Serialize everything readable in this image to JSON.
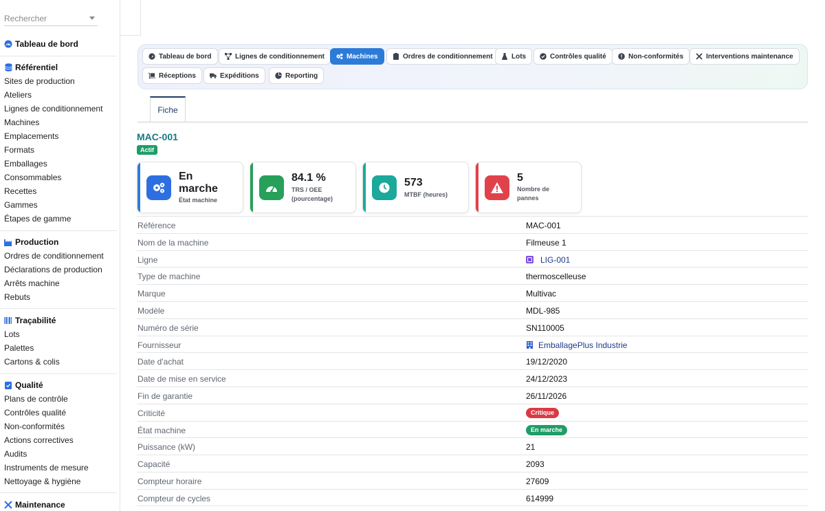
{
  "search": {
    "placeholder": "Rechercher"
  },
  "sidebar": {
    "dashboard": "Tableau de bord",
    "referentiel": {
      "title": "Référentiel",
      "items": [
        "Sites de production",
        "Ateliers",
        "Lignes de conditionnement",
        "Machines",
        "Emplacements",
        "Formats",
        "Emballages",
        "Consommables",
        "Recettes",
        "Gammes",
        "Étapes de gamme"
      ]
    },
    "production": {
      "title": "Production",
      "items": [
        "Ordres de conditionnement",
        "Déclarations de production",
        "Arrêts machine",
        "Rebuts"
      ]
    },
    "tracabilite": {
      "title": "Traçabilité",
      "items": [
        "Lots",
        "Palettes",
        "Cartons & colis"
      ]
    },
    "qualite": {
      "title": "Qualité",
      "items": [
        "Plans de contrôle",
        "Contrôles qualité",
        "Non-conformités",
        "Actions correctives",
        "Audits",
        "Instruments de mesure",
        "Nettoyage & hygiène"
      ]
    },
    "maintenance": {
      "title": "Maintenance"
    }
  },
  "nav_tabs": [
    "Tableau de bord",
    "Lignes de conditionnement",
    "Machines",
    "Ordres de conditionnement",
    "Lots",
    "Contrôles qualité",
    "Non-conformités",
    "Interventions maintenance",
    "Réceptions",
    "Expéditions",
    "Reporting"
  ],
  "active_tab": "Machines",
  "sub_tab": "Fiche",
  "record": {
    "code": "MAC-001",
    "status": "Actif"
  },
  "kpis": [
    {
      "value": "En marche",
      "label": "État machine",
      "color": "#2d6fe0",
      "bar": "#2d7bd8"
    },
    {
      "value": "84.1 %",
      "label": "TRS / OEE (pourcentage)",
      "color": "#27a05a",
      "bar": "#27a05a"
    },
    {
      "value": "573",
      "label": "MTBF (heures)",
      "color": "#1aa99a",
      "bar": "#1aa99a"
    },
    {
      "value": "5",
      "label": "Nombre de pannes",
      "color": "#e0424b",
      "bar": "#e0424b"
    }
  ],
  "fields": [
    {
      "label": "Référence",
      "value": "MAC-001"
    },
    {
      "label": "Nom de la machine",
      "value": "Filmeuse 1"
    },
    {
      "label": "Ligne",
      "value": "LIG-001"
    },
    {
      "label": "Type de machine",
      "value": "thermoscelleuse"
    },
    {
      "label": "Marque",
      "value": "Multivac"
    },
    {
      "label": "Modèle",
      "value": "MDL-985"
    },
    {
      "label": "Numéro de série",
      "value": "SN110005"
    },
    {
      "label": "Fournisseur",
      "value": "EmballagePlus Industrie"
    },
    {
      "label": "Date d'achat",
      "value": "19/12/2020"
    },
    {
      "label": "Date de mise en service",
      "value": "24/12/2023"
    },
    {
      "label": "Fin de garantie",
      "value": "26/11/2026"
    },
    {
      "label": "Criticité",
      "value": "Critique"
    },
    {
      "label": "État machine",
      "value": "En marche"
    },
    {
      "label": "Puissance (kW)",
      "value": "21"
    },
    {
      "label": "Capacité",
      "value": "2093"
    },
    {
      "label": "Compteur horaire",
      "value": "27609"
    },
    {
      "label": "Compteur de cycles",
      "value": "614999"
    }
  ],
  "colors": {
    "accent": "#2d7bd8",
    "title": "#157a85",
    "critique": "#d93a44",
    "en_marche": "#1f9d68"
  }
}
